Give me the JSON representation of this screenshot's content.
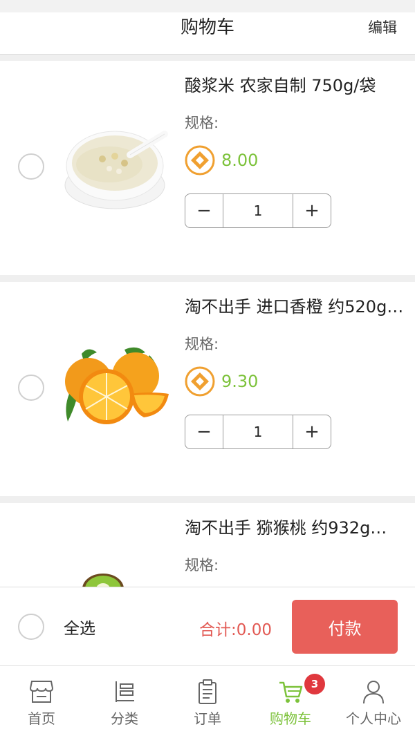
{
  "header": {
    "title": "购物车",
    "edit_label": "编辑"
  },
  "items": [
    {
      "name": "酸浆米 农家自制 750g/袋",
      "spec_label": "规格:",
      "price": "8.00",
      "quantity": "1",
      "image": "rice-porridge-bowl"
    },
    {
      "name": "淘不出手 进口香橙 约520g…",
      "spec_label": "规格:",
      "price": "9.30",
      "quantity": "1",
      "image": "oranges"
    },
    {
      "name": "淘不出手  猕猴桃   约932g…",
      "spec_label": "规格:",
      "price": "",
      "quantity": "",
      "image": "kiwi"
    }
  ],
  "stepper": {
    "minus": "−",
    "plus": "+"
  },
  "footer": {
    "select_all": "全选",
    "total": "合计:0.00",
    "pay_label": "付款"
  },
  "tabbar": {
    "tabs": [
      {
        "label": "首页",
        "icon": "store-icon"
      },
      {
        "label": "分类",
        "icon": "category-icon"
      },
      {
        "label": "订单",
        "icon": "order-icon"
      },
      {
        "label": "购物车",
        "icon": "cart-icon",
        "active": true
      },
      {
        "label": "个人中心",
        "icon": "user-icon"
      }
    ],
    "cart_badge": "3"
  },
  "colors": {
    "accent_green": "#7cc23a",
    "pay_red": "#e8605a",
    "total_red": "#e25a54",
    "badge_red": "#e0383e",
    "coin_orange": "#f0a030"
  }
}
